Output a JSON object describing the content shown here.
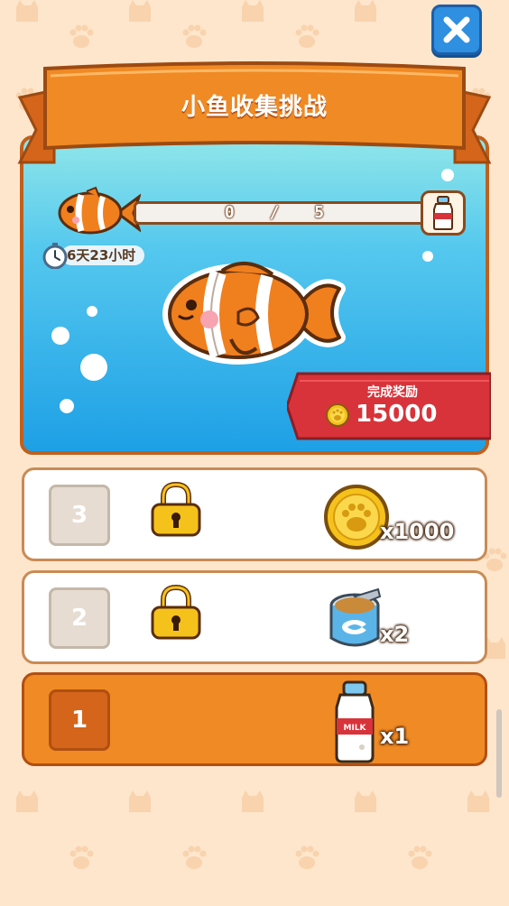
{
  "header": {
    "title": "小鱼收集挑战"
  },
  "progress": {
    "current": 0,
    "total": 5,
    "text": "0 / 5"
  },
  "timer": {
    "remaining": "6天23小时"
  },
  "completion_reward": {
    "label": "完成奖励",
    "amount": "15000"
  },
  "tiers": [
    {
      "number": "3",
      "locked": true,
      "reward_icon": "paw-coin-icon",
      "quantity": "x1000"
    },
    {
      "number": "2",
      "locked": true,
      "reward_icon": "fish-can-icon",
      "quantity": "x2"
    },
    {
      "number": "1",
      "locked": false,
      "reward_icon": "milk-bottle-icon",
      "quantity": "x1"
    }
  ],
  "colors": {
    "ribbon": "#f08a24",
    "active_row": "#f08a24",
    "close_button": "#2f8fe0",
    "reward_banner": "#d8333a"
  }
}
